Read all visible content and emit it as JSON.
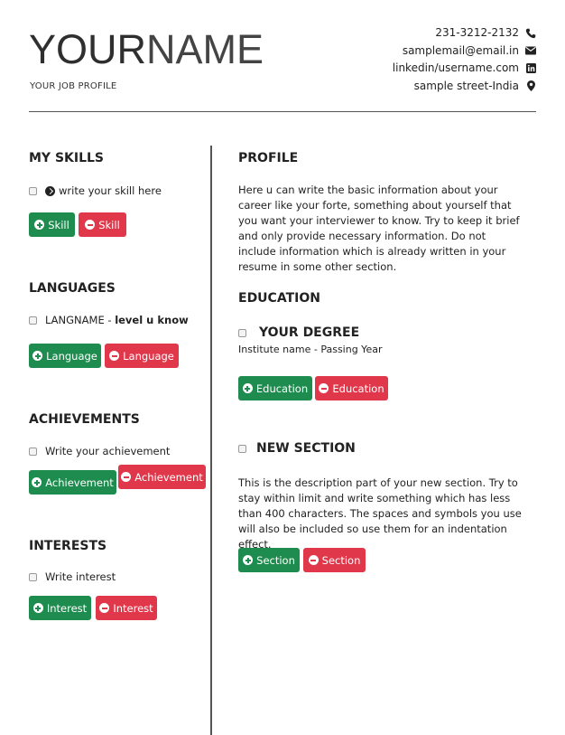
{
  "header": {
    "name_first": "YOUR",
    "name_last": "NAME",
    "job_profile": "YOUR JOB PROFILE",
    "contact": {
      "phone": "231-3212-2132",
      "email": "samplemail@email.in",
      "linkedin": "linkedin/username.com",
      "address": "sample street-India"
    }
  },
  "left": {
    "skills": {
      "heading": "MY SKILLS",
      "item": "write your skill here",
      "add_label": "Skill",
      "remove_label": "Skill"
    },
    "languages": {
      "heading": "LANGUAGES",
      "item_name": "LANGNAME",
      "item_sep": " - ",
      "item_level": "level u know",
      "add_label": "Language",
      "remove_label": "Language"
    },
    "achievements": {
      "heading": "ACHIEVEMENTS",
      "item": "Write your achievement",
      "add_label": "Achievement",
      "remove_label": "Achievement"
    },
    "interests": {
      "heading": "INTERESTS",
      "item": "Write interest",
      "add_label": "Interest",
      "remove_label": "Interest"
    }
  },
  "right": {
    "profile": {
      "heading": "PROFILE",
      "text": "Here u can write the basic information about your career like your forte, something about yourself that you want your interviewer to know. Try to keep it brief and only provide necessary information. Do not include information which is already written in your resume in some other section."
    },
    "education": {
      "heading": "EDUCATION",
      "degree": "YOUR DEGREE",
      "institute": "Institute name - Passing Year",
      "add_label": "Education",
      "remove_label": "Education"
    },
    "new_section": {
      "heading": "NEW SECTION",
      "text": "This is the description part of your new section. Try to stay within limit and write something which has less than 400 characters. The spaces and symbols you use will also be included so use them for an indentation effect.",
      "add_label": "Section",
      "remove_label": "Section"
    }
  },
  "colors": {
    "add_button": "#1f8c4f",
    "remove_button": "#e0374a",
    "divider": "#555555"
  },
  "icons": {
    "phone": "phone-icon",
    "email": "envelope-icon",
    "linkedin": "linkedin-icon",
    "address": "map-marker-icon"
  }
}
